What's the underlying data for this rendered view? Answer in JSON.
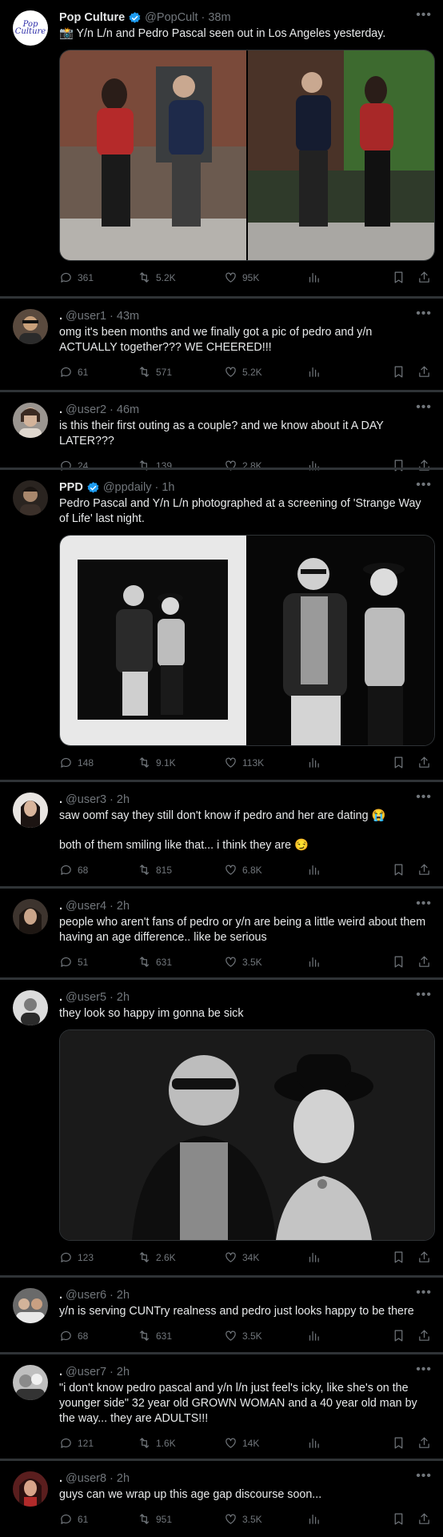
{
  "tweets": [
    {
      "name": "Pop Culture",
      "handle": "@PopCult",
      "time": "38m",
      "avatar_text": "Pop Culture",
      "text": [
        "📸 Y/n L/n and Pedro Pascal seen out in Los Angeles yesterday."
      ],
      "stats": {
        "replies": "361",
        "retweets": "5.2K",
        "likes": "95K"
      }
    },
    {
      "handle": "@user1",
      "time": "43m",
      "text": [
        "omg it's been months and we finally got a pic of pedro and y/n ACTUALLY together??? WE CHEERED!!!"
      ],
      "stats": {
        "replies": "61",
        "retweets": "571",
        "likes": "5.2K"
      }
    },
    {
      "handle": "@user2",
      "time": "46m",
      "text": [
        "is this their first outing as a couple? and we know about it A DAY LATER???"
      ],
      "stats": {
        "replies": "24",
        "retweets": "139",
        "likes": "2.8K"
      }
    },
    {
      "name": "PPD",
      "handle": "@ppdaily",
      "time": "1h",
      "text": [
        "Pedro Pascal and Y/n L/n photographed at a screening of 'Strange Way of Life' last night."
      ],
      "stats": {
        "replies": "148",
        "retweets": "9.1K",
        "likes": "113K"
      }
    },
    {
      "handle": "@user3",
      "time": "2h",
      "text": [
        "saw oomf say they still don't know if pedro and her are dating 😭",
        "both of them smiling like that... i think they are 😏"
      ],
      "stats": {
        "replies": "68",
        "retweets": "815",
        "likes": "6.8K"
      }
    },
    {
      "handle": "@user4",
      "time": "2h",
      "text": [
        "people who aren't fans of pedro or y/n are being a little weird about them having an age difference.. like be serious"
      ],
      "stats": {
        "replies": "51",
        "retweets": "631",
        "likes": "3.5K"
      }
    },
    {
      "handle": "@user5",
      "time": "2h",
      "text": [
        "they look so happy im gonna be sick"
      ],
      "stats": {
        "replies": "123",
        "retweets": "2.6K",
        "likes": "34K"
      }
    },
    {
      "handle": "@user6",
      "time": "2h",
      "text": [
        "y/n is serving CUNTry realness and pedro just looks happy to be there"
      ],
      "stats": {
        "replies": "68",
        "retweets": "631",
        "likes": "3.5K"
      }
    },
    {
      "handle": "@user7",
      "time": "2h",
      "text": [
        "\"i don't know pedro pascal and y/n l/n just feel's icky, like she's on the younger side\" 32 year old GROWN WOMAN and a 40 year old man by the way... they are ADULTS!!!"
      ],
      "stats": {
        "replies": "121",
        "retweets": "1.6K",
        "likes": "14K"
      }
    },
    {
      "handle": "@user8",
      "time": "2h",
      "text": [
        "guys can we wrap up this age gap discourse soon..."
      ],
      "stats": {
        "replies": "61",
        "retweets": "951",
        "likes": "3.5K"
      }
    }
  ],
  "ui": {
    "more_icon": "more-horizontal-icon",
    "verified_color": "#1d9bf0",
    "background": "#000000",
    "muted_color": "#71767b"
  }
}
